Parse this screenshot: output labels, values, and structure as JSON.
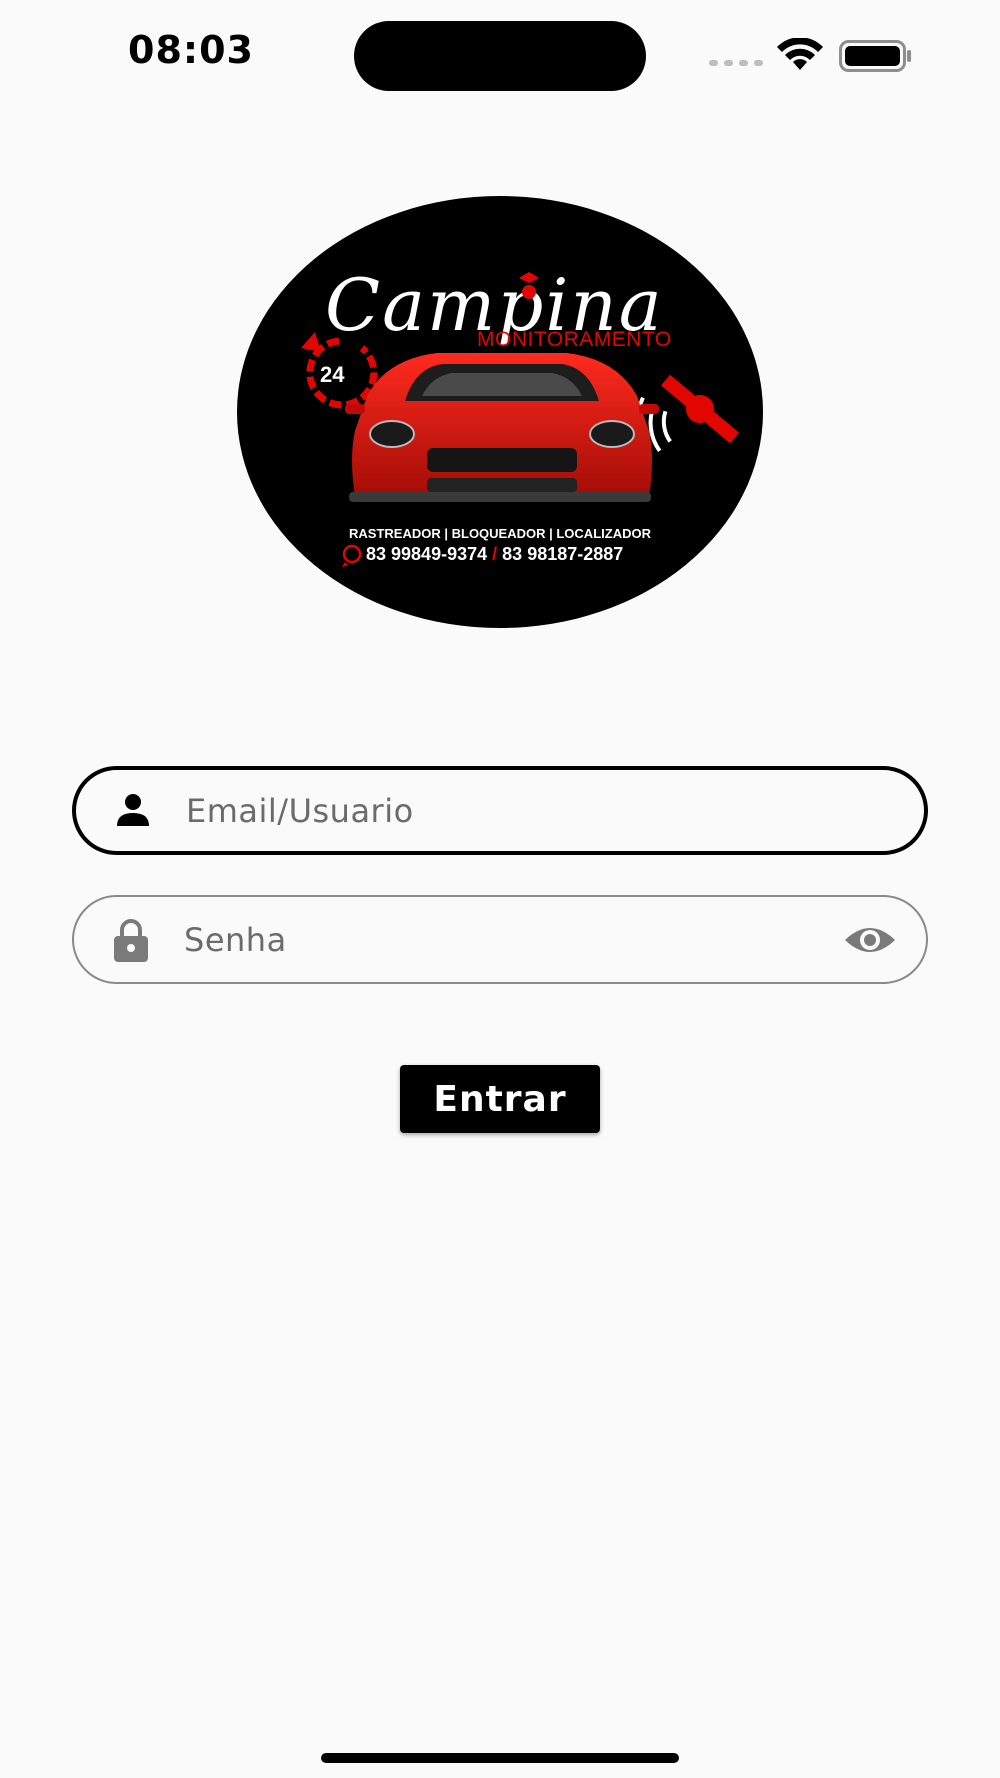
{
  "status_bar": {
    "time": "08:03"
  },
  "logo": {
    "brand_name": "Campina",
    "brand_subtitle": "MONITORAMENTO",
    "badge_number": "24",
    "services": "RASTREADOR | BLOQUEADOR | LOCALIZADOR",
    "phone_1": "83 99849-9374",
    "phone_separator": "/",
    "phone_2": "83 98187-2887"
  },
  "login_form": {
    "email_placeholder": "Email/Usuario",
    "email_value": "",
    "password_placeholder": "Senha",
    "password_value": "",
    "submit_label": "Entrar"
  },
  "colors": {
    "background": "#fafafa",
    "primary": "#000000",
    "brand_red": "#e10600",
    "muted_icon": "#7a7a7a"
  },
  "icons": {
    "email_field": "person-icon",
    "password_field": "lock-icon",
    "password_toggle": "eye-icon",
    "wifi": "wifi-icon",
    "battery": "battery-icon"
  }
}
